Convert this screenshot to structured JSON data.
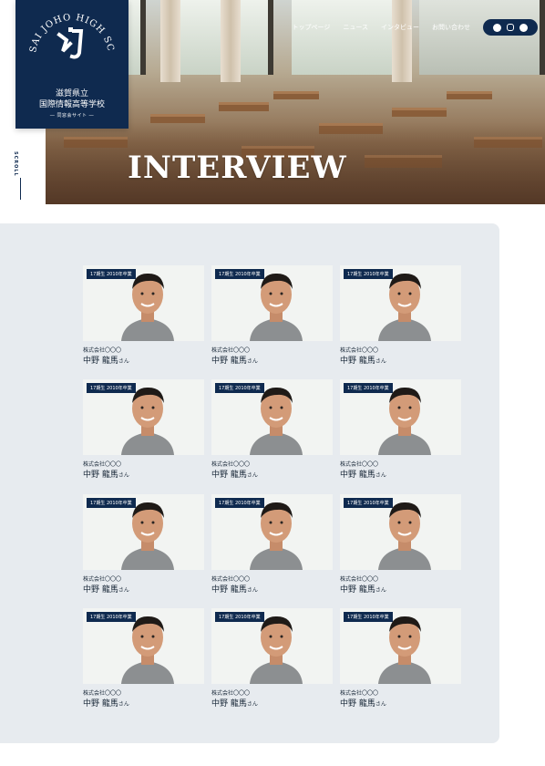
{
  "hero": {
    "title": "INTERVIEW"
  },
  "nav": {
    "items": [
      "トップページ",
      "ニュース",
      "インタビュー",
      "お問い合わせ"
    ]
  },
  "social": [
    "facebook-icon",
    "instagram-icon",
    "line-icon"
  ],
  "logo": {
    "arc_text": "KOKUSAI JOHO HIGH SCHOOL",
    "prefecture": "滋賀県立",
    "school_name": "国際情報高等学校",
    "subtitle": "― 同窓会サイト ―"
  },
  "side_label": "SCROLL",
  "cards": [
    {
      "badge": "17期生 2010年卒業",
      "company": "株式会社〇〇〇",
      "name": "中野 龍馬",
      "honorific": "さん"
    },
    {
      "badge": "17期生 2010年卒業",
      "company": "株式会社〇〇〇",
      "name": "中野 龍馬",
      "honorific": "さん"
    },
    {
      "badge": "17期生 2010年卒業",
      "company": "株式会社〇〇〇",
      "name": "中野 龍馬",
      "honorific": "さん"
    },
    {
      "badge": "17期生 2010年卒業",
      "company": "株式会社〇〇〇",
      "name": "中野 龍馬",
      "honorific": "さん"
    },
    {
      "badge": "17期生 2010年卒業",
      "company": "株式会社〇〇〇",
      "name": "中野 龍馬",
      "honorific": "さん"
    },
    {
      "badge": "17期生 2010年卒業",
      "company": "株式会社〇〇〇",
      "name": "中野 龍馬",
      "honorific": "さん"
    },
    {
      "badge": "17期生 2010年卒業",
      "company": "株式会社〇〇〇",
      "name": "中野 龍馬",
      "honorific": "さん"
    },
    {
      "badge": "17期生 2010年卒業",
      "company": "株式会社〇〇〇",
      "name": "中野 龍馬",
      "honorific": "さん"
    },
    {
      "badge": "17期生 2010年卒業",
      "company": "株式会社〇〇〇",
      "name": "中野 龍馬",
      "honorific": "さん"
    },
    {
      "badge": "17期生 2010年卒業",
      "company": "株式会社〇〇〇",
      "name": "中野 龍馬",
      "honorific": "さん"
    },
    {
      "badge": "17期生 2010年卒業",
      "company": "株式会社〇〇〇",
      "name": "中野 龍馬",
      "honorific": "さん"
    },
    {
      "badge": "17期生 2010年卒業",
      "company": "株式会社〇〇〇",
      "name": "中野 龍馬",
      "honorific": "さん"
    }
  ],
  "colors": {
    "navy": "#0f2a4f",
    "panel": "#e7ebef"
  }
}
